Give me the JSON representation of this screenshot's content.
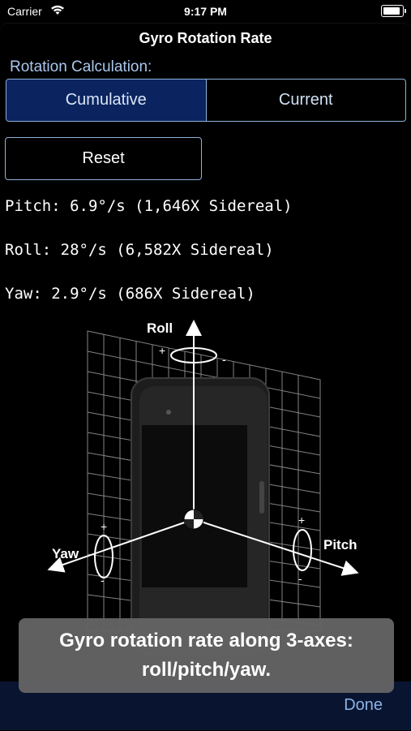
{
  "status_bar": {
    "carrier": "Carrier",
    "time": "9:17 PM"
  },
  "header": {
    "title": "Gyro Rotation Rate"
  },
  "rotation": {
    "label": "Rotation Calculation:",
    "options": [
      "Cumulative",
      "Current"
    ],
    "selected": "Cumulative"
  },
  "reset_label": "Reset",
  "readings": {
    "pitch": "Pitch: 6.9°/s (1,646X Sidereal)",
    "roll": "Roll: 28°/s (6,582X Sidereal)",
    "yaw": "Yaw: 2.9°/s (686X Sidereal)"
  },
  "diagram": {
    "roll_label": "Roll",
    "pitch_label": "Pitch",
    "yaw_label": "Yaw",
    "plus": "+",
    "minus": "-"
  },
  "toast": {
    "line1": "Gyro rotation rate along 3-axes:",
    "line2": "roll/pitch/yaw."
  },
  "done_label": "Done",
  "colors": {
    "accent": "#8fb1d8",
    "selected_segment": "#0b245f",
    "label_blue": "#a9c7ee"
  }
}
